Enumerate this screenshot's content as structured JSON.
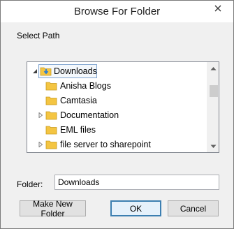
{
  "window": {
    "title": "Browse For Folder"
  },
  "dialog": {
    "select_label": "Select Path",
    "folder_label": "Folder:",
    "folder_value": "Downloads"
  },
  "tree": {
    "items": [
      {
        "label": "Downloads",
        "expander": "expanded",
        "selected": true
      },
      {
        "label": "Anisha Blogs",
        "expander": "none"
      },
      {
        "label": "Camtasia",
        "expander": "none"
      },
      {
        "label": "Documentation",
        "expander": "collapsed"
      },
      {
        "label": "EML files",
        "expander": "none"
      },
      {
        "label": "file server to sharepoint",
        "expander": "collapsed"
      }
    ],
    "icons": {
      "downloads": "downloads-folder-icon",
      "folder": "folder-icon"
    }
  },
  "buttons": {
    "new_folder": "Make New Folder",
    "ok": "OK",
    "cancel": "Cancel"
  },
  "colors": {
    "folder": "#f4c542",
    "download_arrow": "#2a7dd6",
    "selection_border": "#7da2ce",
    "default_button_border": "#3c7fb1"
  }
}
